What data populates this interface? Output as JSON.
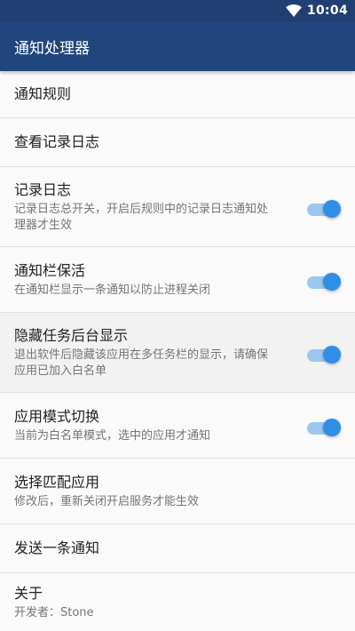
{
  "status": {
    "time": "10:04"
  },
  "appbar": {
    "title": "通知处理器"
  },
  "items": [
    {
      "title": "通知规则"
    },
    {
      "title": "查看记录日志"
    },
    {
      "title": "记录日志",
      "summary": "记录日志总开关，开启后规则中的记录日志通知处理器才生效",
      "switch": true
    },
    {
      "title": "通知栏保活",
      "summary": "在通知栏显示一条通知以防止进程关闭",
      "switch": true
    },
    {
      "title": "隐藏任务后台显示",
      "summary": "退出软件后隐藏该应用在多任务栏的显示，请确保应用已加入白名单",
      "switch": true
    },
    {
      "title": "应用模式切换",
      "summary": "当前为白名单模式，选中的应用才通知",
      "switch": true
    },
    {
      "title": "选择匹配应用",
      "summary": "修改后，重新关闭开启服务才能生效"
    },
    {
      "title": "发送一条通知"
    },
    {
      "title": "关于",
      "summary": "开发者：Stone"
    }
  ],
  "colors": {
    "primary": "#21457d",
    "accent": "#2f8fe6"
  }
}
